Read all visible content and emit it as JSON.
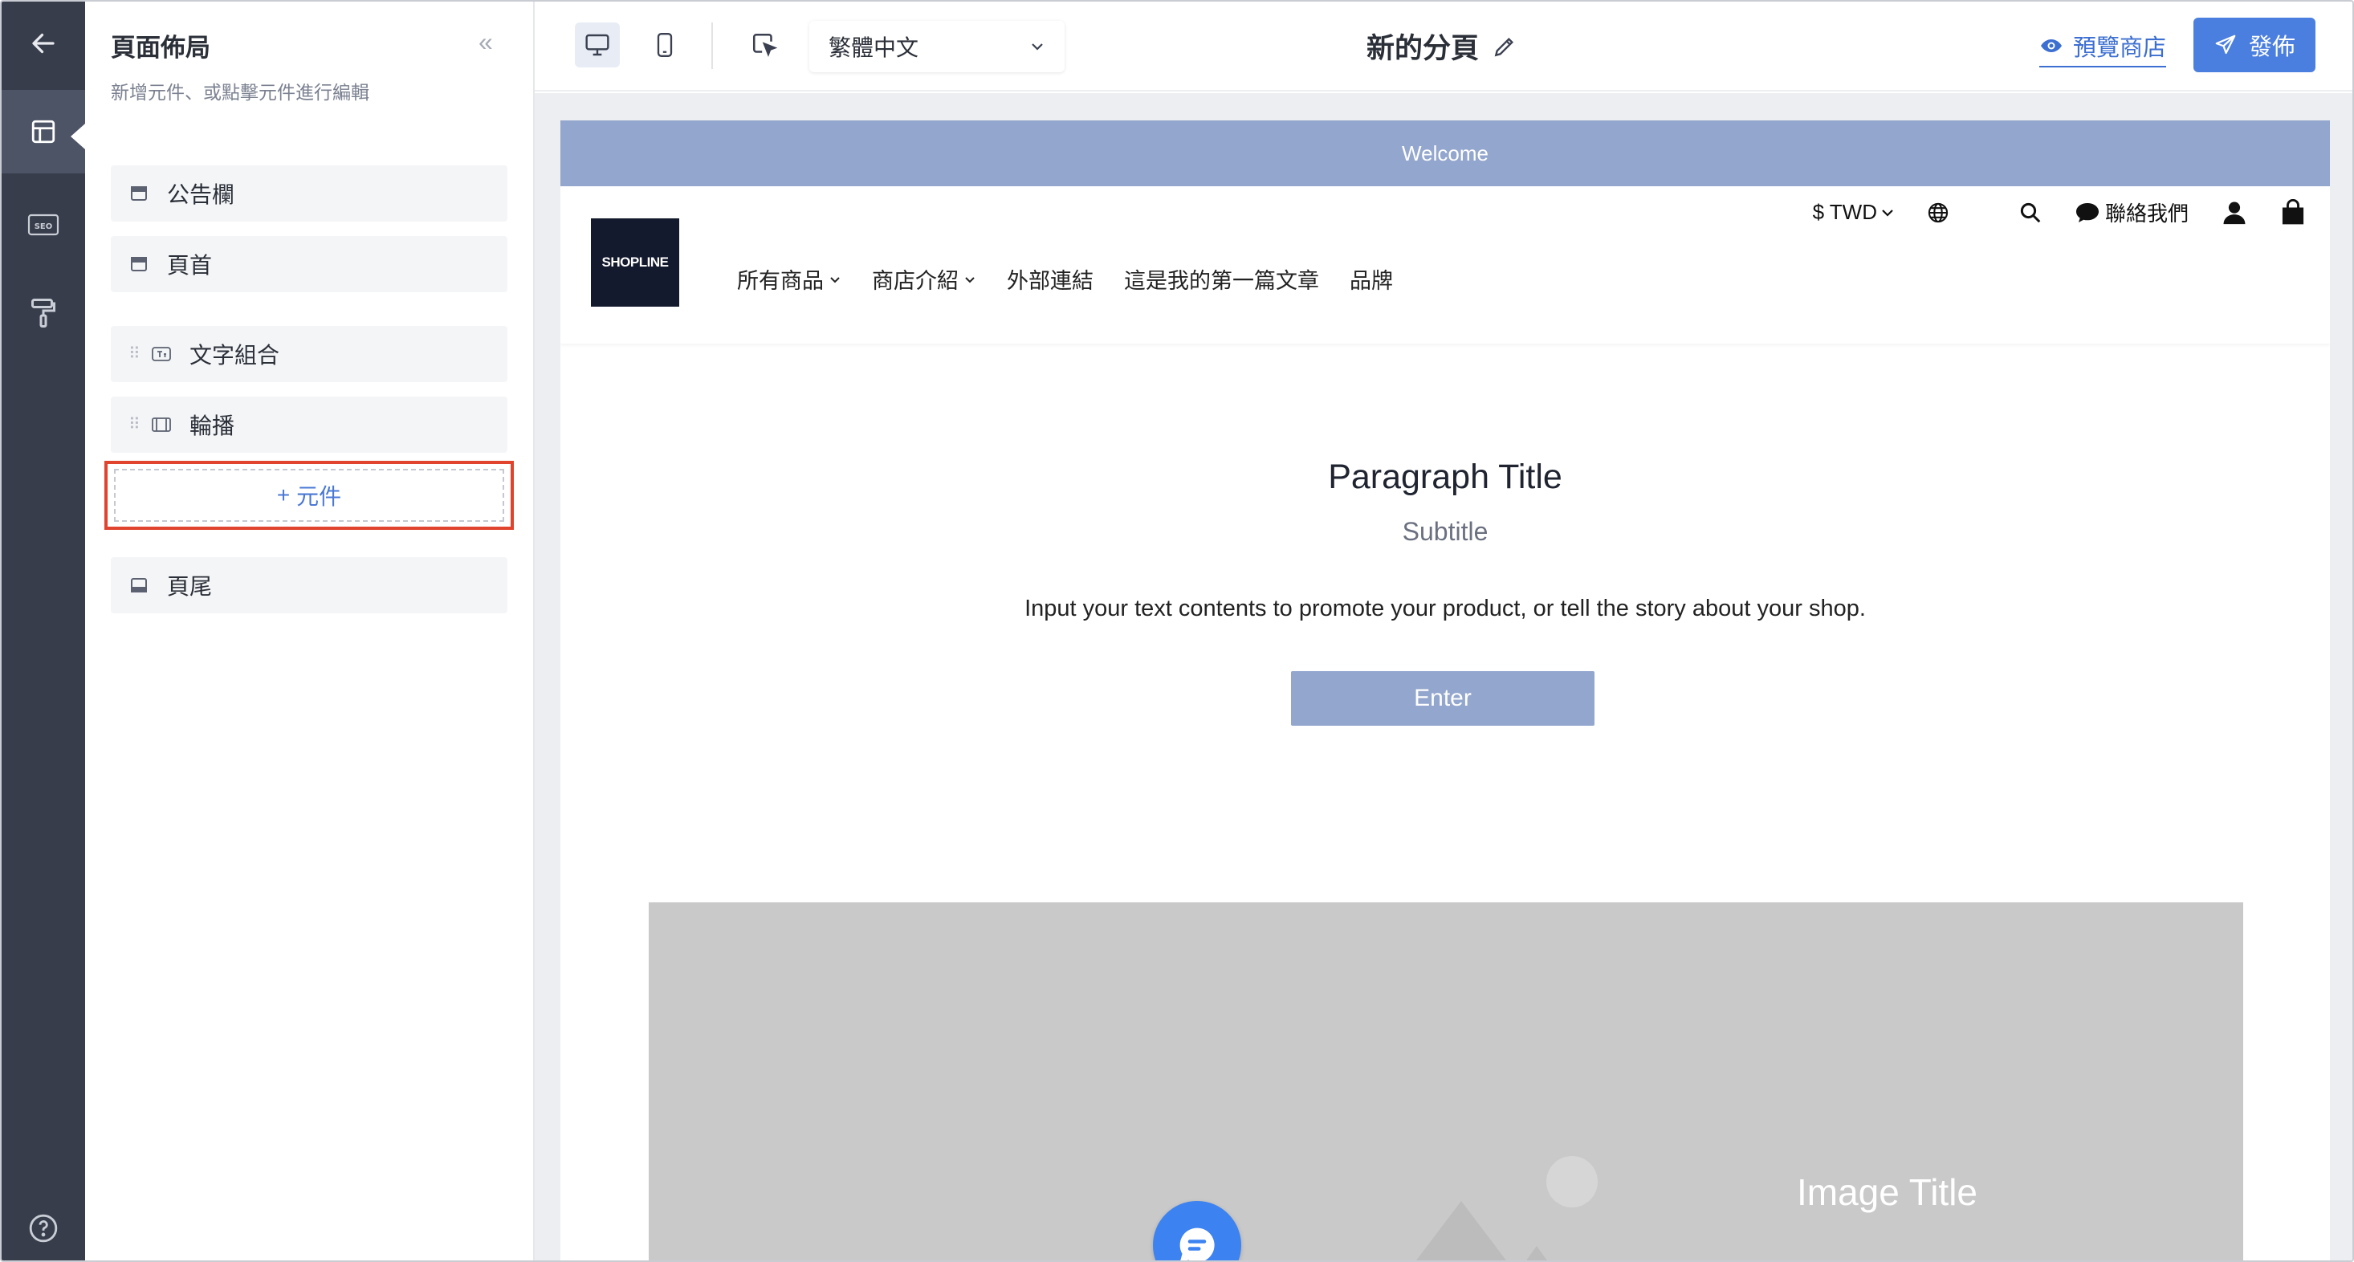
{
  "rail": {
    "items": [
      "back-arrow-icon",
      "layout-icon",
      "seo-icon",
      "paint-roller-icon",
      "help-icon"
    ]
  },
  "panel": {
    "title": "頁面佈局",
    "subtitle": "新增元件、或點擊元件進行編輯",
    "collapse_glyph": "«",
    "rows": {
      "announcement": "公告欄",
      "header": "頁首",
      "text_group": "文字組合",
      "carousel": "輪播",
      "footer": "頁尾"
    },
    "add_component": "元件",
    "add_glyph": "+"
  },
  "topbar": {
    "language": "繁體中文",
    "page_name": "新的分頁",
    "preview": "預覽商店",
    "publish": "發佈"
  },
  "store": {
    "announcement": "Welcome",
    "logo_text": "SHOPLINE",
    "nav": [
      "所有商品",
      "商店介紹",
      "外部連結",
      "這是我的第一篇文章",
      "品牌"
    ],
    "currency": "$ TWD",
    "contact": "聯絡我們",
    "paragraph_title": "Paragraph Title",
    "subtitle": "Subtitle",
    "body": "Input your text contents to promote your product, or tell the story about your shop.",
    "enter": "Enter",
    "image_title": "Image Title"
  },
  "colors": {
    "rail": "#373d4b",
    "accent": "#4b7fdf",
    "announce": "#93a6cd",
    "highlight": "#e0432e"
  }
}
